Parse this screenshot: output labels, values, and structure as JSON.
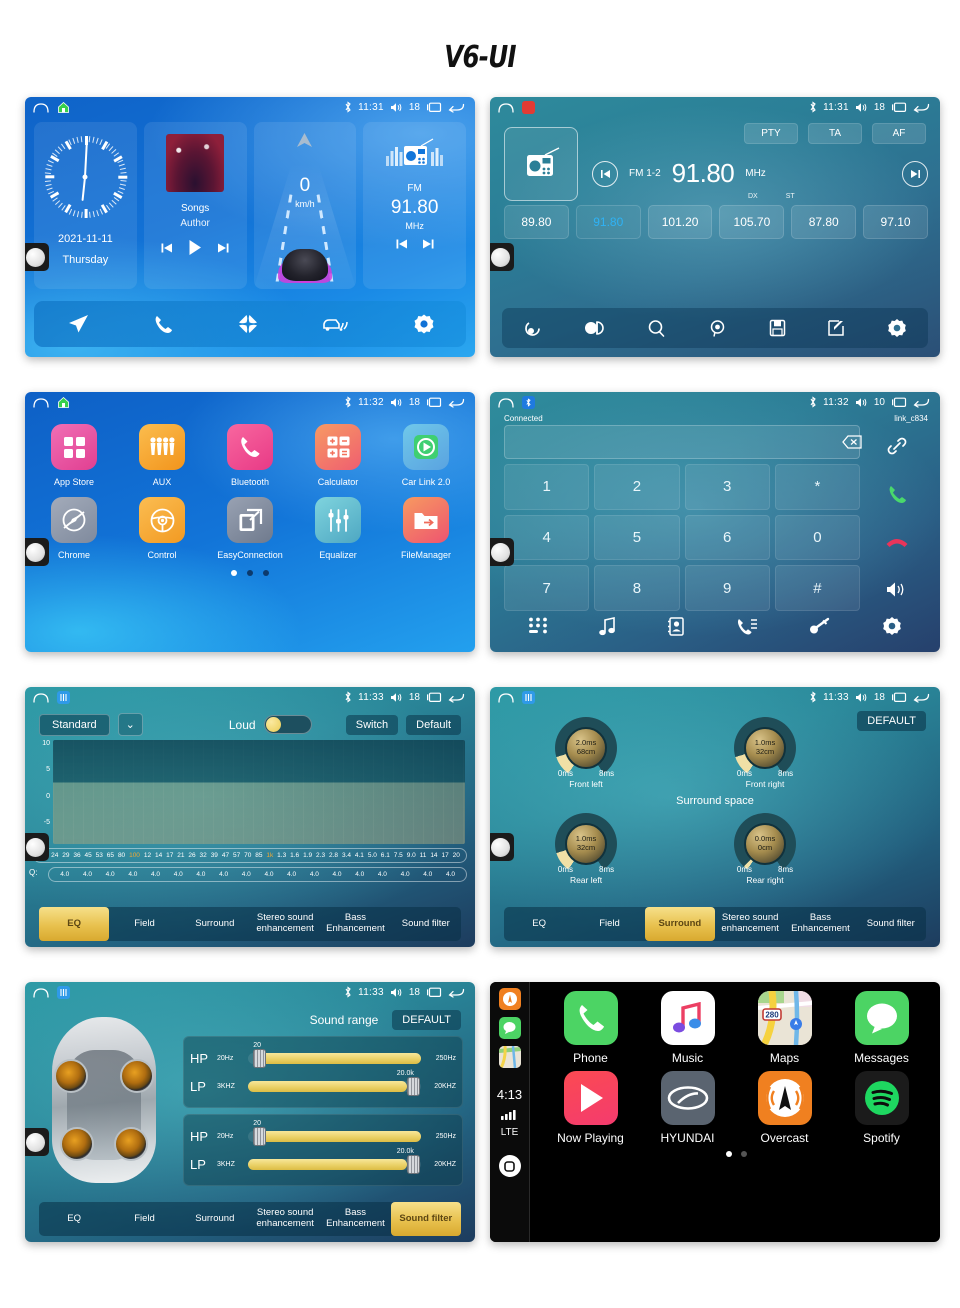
{
  "title": "V6-UI",
  "screens": {
    "home": {
      "name": "Home screen",
      "statusbar": {
        "time": "11:31",
        "volume": "18"
      },
      "clock": {
        "date": "2021-11-11",
        "weekday": "Thursday"
      },
      "music": {
        "title": "Songs",
        "author": "Author"
      },
      "speed": {
        "value": "0",
        "unit": "km/h"
      },
      "radio": {
        "band": "FM",
        "freq": "91.80",
        "unit": "MHz"
      },
      "dock": [
        "navigation-icon",
        "phone-icon",
        "apps-icon",
        "carlink-icon",
        "settings-icon"
      ]
    },
    "radio": {
      "name": "FM Radio",
      "statusbar": {
        "time": "11:31",
        "volume": "18"
      },
      "rds": {
        "pty": "PTY",
        "ta": "TA",
        "af": "AF"
      },
      "band": "FM 1-2",
      "freq": "91.80",
      "unit": "MHz",
      "dx": "DX",
      "st": "ST",
      "presets": [
        "89.80",
        "91.80",
        "101.20",
        "105.70",
        "87.80",
        "97.10"
      ],
      "active_preset_index": 1,
      "toolbar": [
        "band-icon",
        "stereo-toggle-icon",
        "search-icon",
        "scan-icon",
        "save-icon",
        "edit-icon",
        "settings-icon"
      ]
    },
    "apps": {
      "name": "App list",
      "statusbar": {
        "time": "11:32",
        "volume": "18"
      },
      "row1": [
        {
          "label": "App Store",
          "icon": "grid-icon",
          "color": "#e84b9c"
        },
        {
          "label": "AUX",
          "icon": "aux-icon",
          "color": "#f6a020"
        },
        {
          "label": "Bluetooth",
          "icon": "phone-icon",
          "color": "#ed4a8e"
        },
        {
          "label": "Calculator",
          "icon": "calculator-icon",
          "color": "#f2705b"
        },
        {
          "label": "Car Link 2.0",
          "icon": "play-icon",
          "color": "#3fc17a"
        }
      ],
      "row2": [
        {
          "label": "Chrome",
          "icon": "compass-icon",
          "color": "#8d96a8"
        },
        {
          "label": "Control",
          "icon": "steering-wheel-icon",
          "color": "#f6a733"
        },
        {
          "label": "EasyConnection",
          "icon": "screen-mirror-icon",
          "color": "#7e8798"
        },
        {
          "label": "Equalizer",
          "icon": "sliders-icon",
          "color": "#5ab9c4"
        },
        {
          "label": "FileManager",
          "icon": "folder-icon",
          "color": "#ef6b5a"
        }
      ],
      "page_count": 3,
      "active_page": 1
    },
    "dialer": {
      "name": "Bluetooth dialer",
      "statusbar": {
        "time": "11:32",
        "volume": "10"
      },
      "status_label": "Connected",
      "device_name": "link_c834",
      "number_value": "",
      "keys": [
        "1",
        "2",
        "3",
        "*",
        "4",
        "5",
        "6",
        "0",
        "7",
        "8",
        "9",
        "#"
      ],
      "side_buttons": [
        "link-icon",
        "call-answer-icon",
        "call-end-icon",
        "speaker-icon"
      ],
      "toolbar": [
        "dialpad-icon",
        "music-icon",
        "contacts-icon",
        "call-log-icon",
        "disconnect-icon",
        "settings-icon"
      ]
    },
    "eq": {
      "name": "Equalizer",
      "statusbar": {
        "time": "11:33",
        "volume": "18"
      },
      "preset": "Standard",
      "loud_label": "Loud",
      "loud_on": true,
      "switch_label": "Switch",
      "default_label": "Default",
      "y_ticks": [
        "10",
        "5",
        "0",
        "-5"
      ],
      "frequencies": [
        "20",
        "24",
        "29",
        "36",
        "45",
        "53",
        "65",
        "80",
        "100",
        "12",
        "14",
        "17",
        "21",
        "26",
        "32",
        "39",
        "47",
        "57",
        "70",
        "85",
        "1k",
        "1.3",
        "1.6",
        "1.9",
        "2.3",
        "2.8",
        "3.4",
        "4.1",
        "5.0",
        "6.1",
        "7.5",
        "9.0",
        "11",
        "14",
        "17",
        "20"
      ],
      "highlight_freqs": [
        "100",
        "1k"
      ],
      "q_label": "Q:",
      "q_values": [
        "4.0",
        "4.0",
        "4.0",
        "4.0",
        "4.0",
        "4.0",
        "4.0",
        "4.0",
        "4.0",
        "4.0",
        "4.0",
        "4.0",
        "4.0",
        "4.0",
        "4.0",
        "4.0",
        "4.0",
        "4.0"
      ],
      "tabs": [
        "EQ",
        "Field",
        "Surround",
        "Stereo sound enhancement",
        "Bass Enhancement",
        "Sound filter"
      ],
      "active_tab": "EQ"
    },
    "surround": {
      "name": "Surround space",
      "statusbar": {
        "time": "11:33",
        "volume": "18"
      },
      "default_label": "DEFAULT",
      "center_label": "Surround space",
      "knobs": [
        {
          "name": "Front left",
          "delay": "2.0ms",
          "distance": "68cm",
          "min": "0ms",
          "max": "8ms"
        },
        {
          "name": "Front right",
          "delay": "1.0ms",
          "distance": "32cm",
          "min": "0ms",
          "max": "8ms"
        },
        {
          "name": "Rear left",
          "delay": "1.0ms",
          "distance": "32cm",
          "min": "0ms",
          "max": "8ms"
        },
        {
          "name": "Rear right",
          "delay": "0.0ms",
          "distance": "0cm",
          "min": "0ms",
          "max": "8ms"
        }
      ],
      "tabs": [
        "EQ",
        "Field",
        "Surround",
        "Stereo sound enhancement",
        "Bass Enhancement",
        "Sound filter"
      ],
      "active_tab": "Surround"
    },
    "soundfilter": {
      "name": "Sound filter",
      "statusbar": {
        "time": "11:33",
        "volume": "18"
      },
      "title": "Sound range",
      "default_label": "DEFAULT",
      "groups": [
        {
          "rows": [
            {
              "type": "HP",
              "low": "20Hz",
              "high": "250Hz",
              "value": "20",
              "pos": 3
            },
            {
              "type": "LP",
              "low": "3KHZ",
              "high": "20KHZ",
              "value": "20.0k",
              "pos": 92
            }
          ]
        },
        {
          "rows": [
            {
              "type": "HP",
              "low": "20Hz",
              "high": "250Hz",
              "value": "20",
              "pos": 3
            },
            {
              "type": "LP",
              "low": "3KHZ",
              "high": "20KHZ",
              "value": "20.0k",
              "pos": 92
            }
          ]
        }
      ],
      "tabs": [
        "EQ",
        "Field",
        "Surround",
        "Stereo sound enhancement",
        "Bass Enhancement",
        "Sound filter"
      ],
      "active_tab": "Sound filter"
    },
    "carplay": {
      "name": "Apple CarPlay",
      "time": "4:13",
      "network": "LTE",
      "rail": [
        "overcast-icon",
        "messages-icon",
        "maps-icon"
      ],
      "row1": [
        {
          "label": "Phone",
          "icon": "phone-icon",
          "color": "#4cd464"
        },
        {
          "label": "Music",
          "icon": "music-note-icon",
          "color": "#ffffff"
        },
        {
          "label": "Maps",
          "icon": "map-icon",
          "color": "#e8e3d8"
        },
        {
          "label": "Messages",
          "icon": "message-bubble-icon",
          "color": "#4cd464"
        }
      ],
      "row2": [
        {
          "label": "Now Playing",
          "icon": "play-icon",
          "color": "#fc4853"
        },
        {
          "label": "HYUNDAI",
          "icon": "hyundai-logo-icon",
          "color": "#5a6470"
        },
        {
          "label": "Overcast",
          "icon": "overcast-icon",
          "color": "#f08020"
        },
        {
          "label": "Spotify",
          "icon": "spotify-icon",
          "color": "#1b1b1b"
        }
      ],
      "page_count": 2,
      "active_page": 1
    }
  }
}
